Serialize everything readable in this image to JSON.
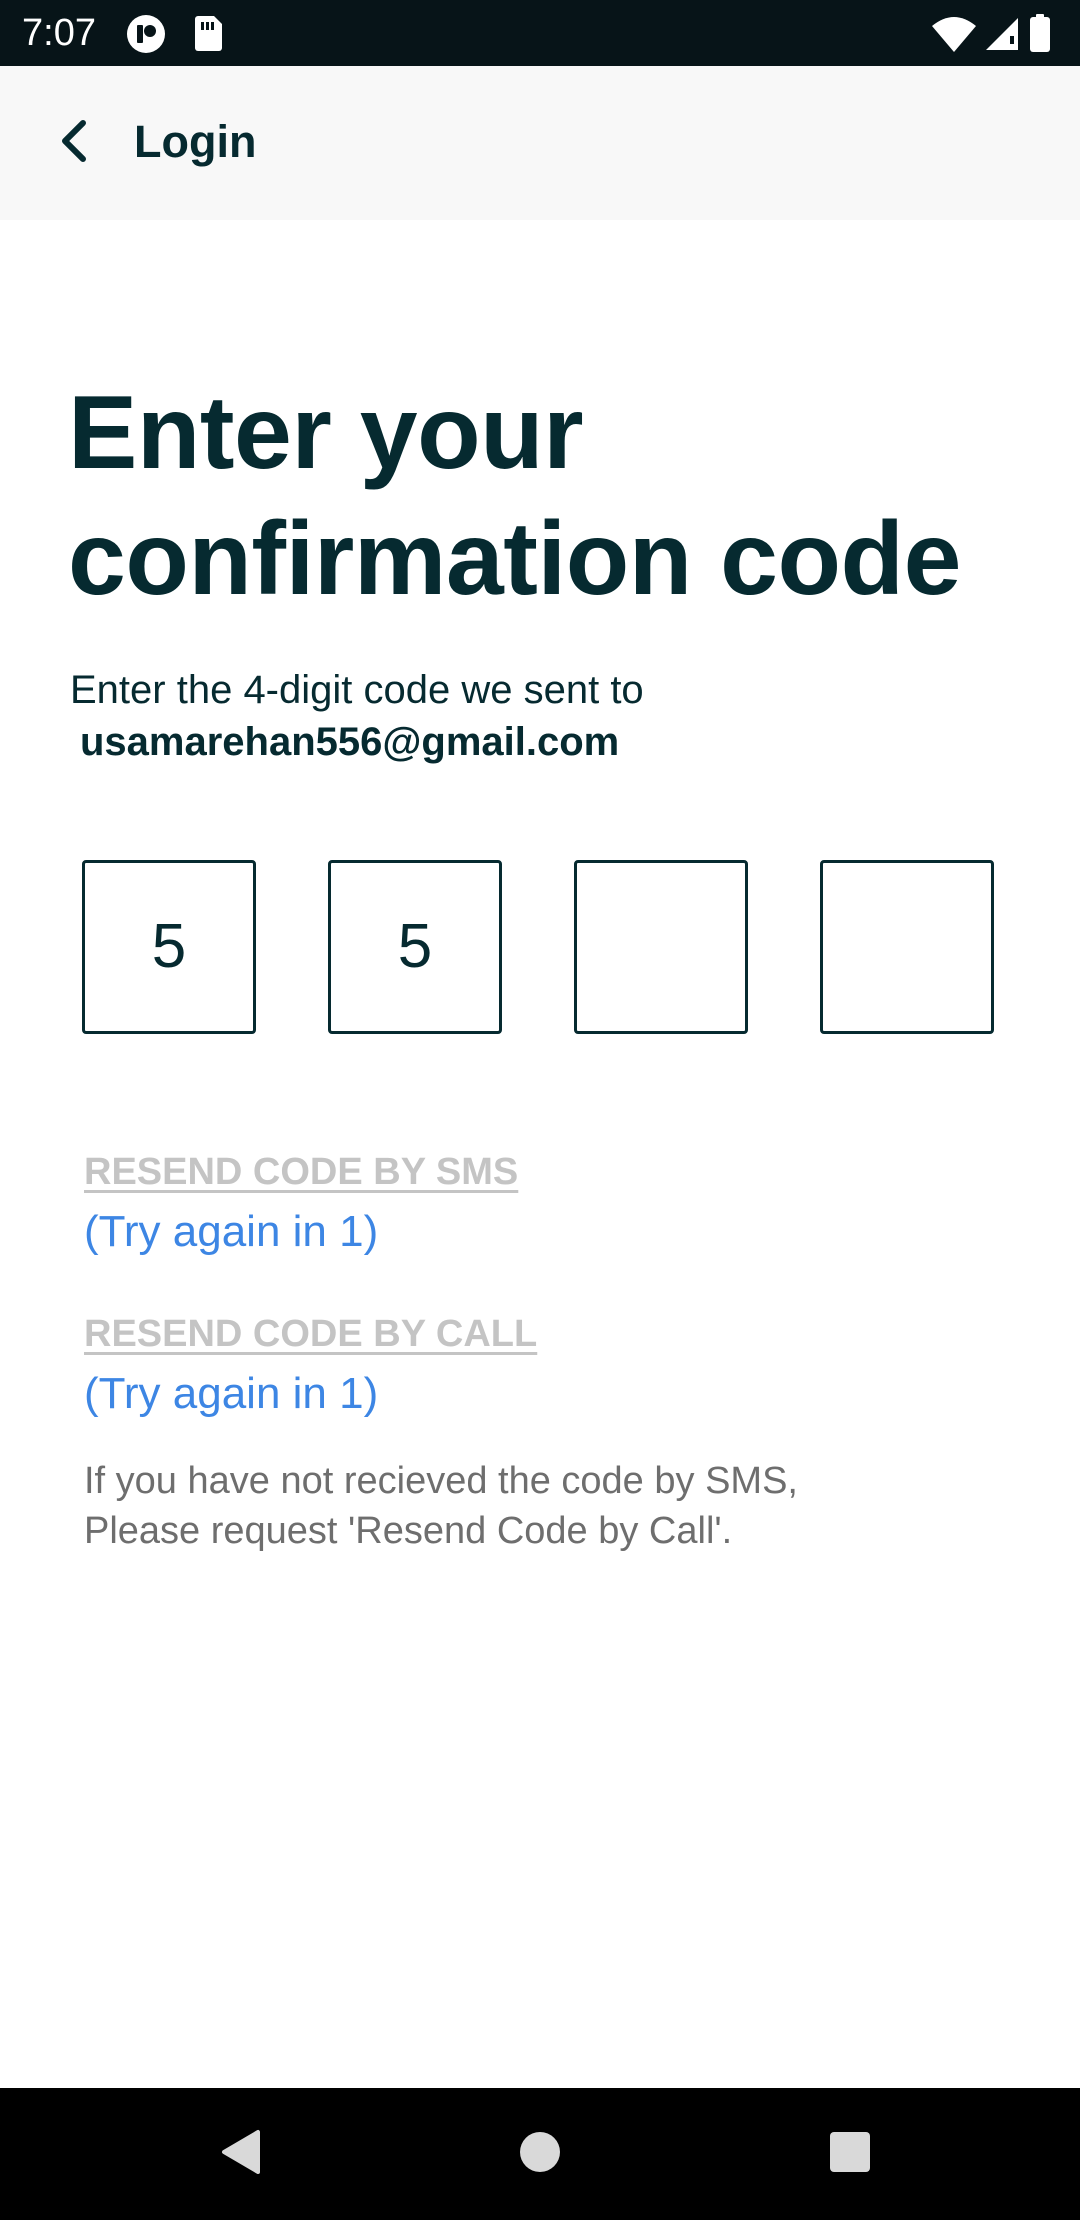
{
  "status_bar": {
    "time": "7:07",
    "left_icons": [
      "vpn-icon",
      "sim-card-icon"
    ],
    "right_icons": [
      "wifi-icon",
      "cellular-signal-icon",
      "battery-icon"
    ]
  },
  "app_bar": {
    "back_icon": "chevron-left-icon",
    "title": "Login"
  },
  "main": {
    "headline": "Enter your confirmation code",
    "instruction": "Enter the 4-digit code we sent to",
    "email": "usamarehan556@gmail.com",
    "code_digits": [
      "5",
      "5",
      "",
      ""
    ],
    "resend_sms_label": "RESEND CODE BY SMS",
    "resend_sms_timer": "(Try again in 1)",
    "resend_call_label": "RESEND CODE BY CALL",
    "resend_call_timer": "(Try again in 1)",
    "help_line1": "If you have not recieved the code by SMS,",
    "help_line2": "Please request 'Resend Code by Call'."
  },
  "nav_bar": {
    "icons": [
      "back-triangle-icon",
      "home-circle-icon",
      "recents-square-icon"
    ]
  },
  "colors": {
    "primary_text": "#062a30",
    "link_blue": "#3d86e4",
    "disabled_gray": "#c4c4c4",
    "help_gray": "#6e6e6e",
    "status_bar_bg": "#071418",
    "app_bar_bg": "#f8f8f8"
  }
}
